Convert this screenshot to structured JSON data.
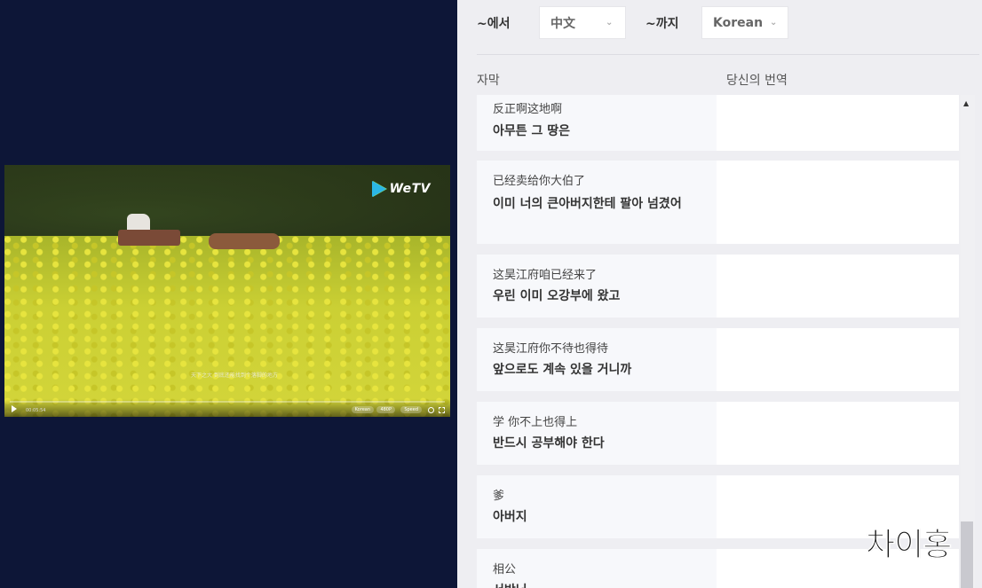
{
  "video": {
    "logo_text": "WeTV",
    "subtitle_text": "天下之大 到底还能找到个落脚的地方",
    "time_text": "00:05:54",
    "progress": 0.0,
    "controls": {
      "chip_subs": "Korean",
      "chip_quality": "480P",
      "chip_speed": "Speed"
    }
  },
  "translation": {
    "from_label": "~에서",
    "from_value": "中文",
    "to_label": "~까지",
    "to_value": "Korean",
    "col_subtitle": "자막",
    "col_yours": "당신의 번역"
  },
  "subtitles": [
    {
      "source": "反正啊这地啊",
      "translation": "아무튼 그 땅은",
      "active": false
    },
    {
      "source": "已经卖给你大伯了",
      "translation": "이미 너의 큰아버지한테 팔아 넘겼어",
      "active": true
    },
    {
      "source": "这昊江府咱已经来了",
      "translation": "우린 이미 오강부에 왔고",
      "active": false
    },
    {
      "source": "这昊江府你不待也得待",
      "translation": "앞으로도 계속 있을 거니까",
      "active": false
    },
    {
      "source": "学 你不上也得上",
      "translation": "반드시 공부해야 한다",
      "active": false
    },
    {
      "source": "爹",
      "translation": "아버지",
      "active": false
    },
    {
      "source": "相公",
      "translation": "서방님",
      "active": false
    }
  ],
  "watermark": "차이홍",
  "colors": {
    "accent_active": "#e8413d",
    "page_dark": "#0d1637",
    "panel_bg": "#eeeef2"
  }
}
